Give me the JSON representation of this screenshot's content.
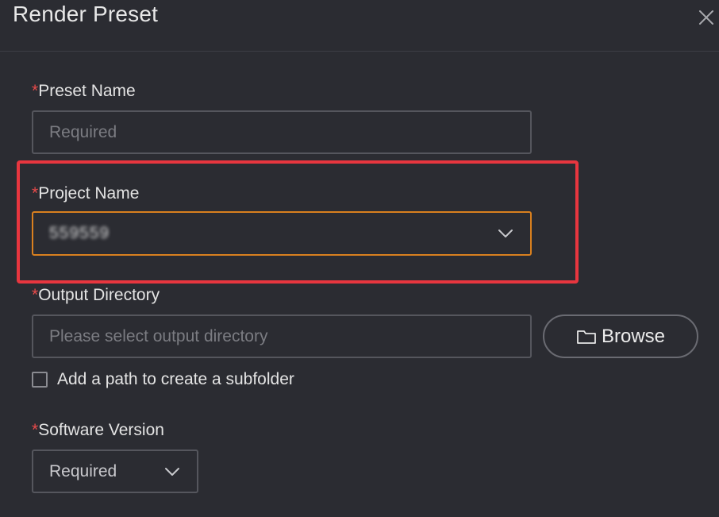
{
  "dialog": {
    "title": "Render Preset"
  },
  "form": {
    "required_marker": "*",
    "preset_name": {
      "label": "Preset Name",
      "placeholder": "Required",
      "value": ""
    },
    "project_name": {
      "label": "Project Name",
      "value": "559559",
      "value_obscured": true
    },
    "output_directory": {
      "label": "Output Directory",
      "placeholder": "Please select output directory",
      "value": "",
      "browse_label": "Browse"
    },
    "subfolder": {
      "label": "Add a path to create a subfolder",
      "checked": false
    },
    "software_version": {
      "label": "Software Version",
      "value": "Required"
    }
  },
  "icons": {
    "close": "close-icon",
    "dropdown": "chevron-down-icon",
    "folder": "folder-icon"
  },
  "colors": {
    "background": "#2b2c32",
    "required_marker": "#e84a4a",
    "focus_border": "#d9801f",
    "annotation_highlight": "#e8363f",
    "input_border": "#55565d"
  }
}
